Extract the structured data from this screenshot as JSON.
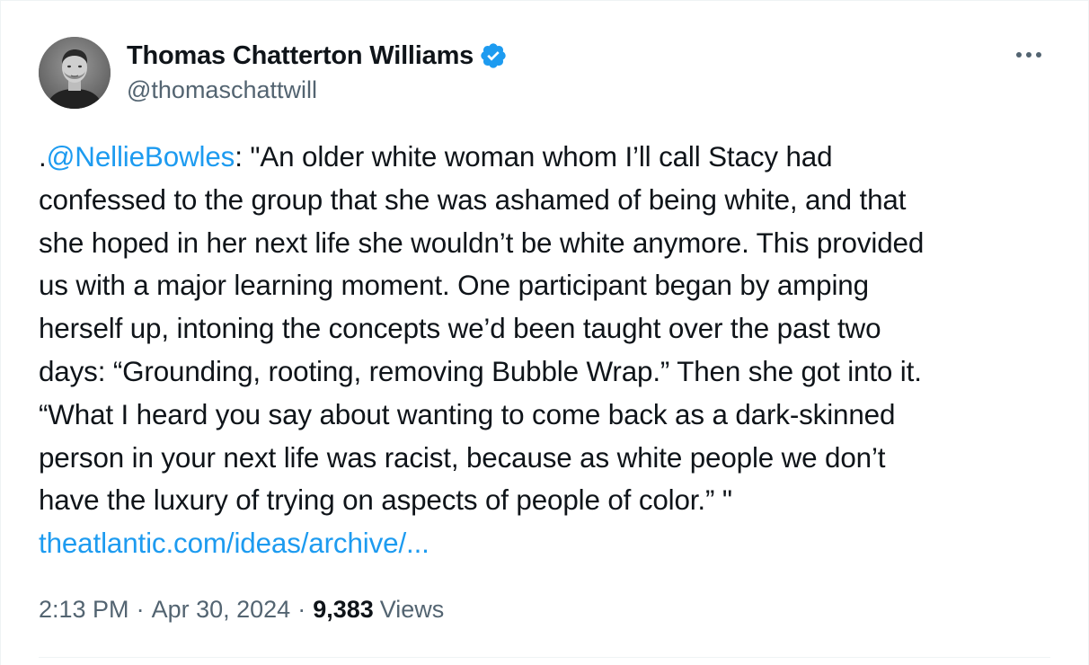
{
  "author": {
    "display_name": "Thomas Chatterton Williams",
    "handle": "@thomaschattwill",
    "verified": true,
    "avatar_icon": "profile-photo"
  },
  "menu_icon": "more-horizontal-icon",
  "tweet": {
    "mention": "@NellieBowles",
    "lines": [
      "\"An older white woman whom I’ll call Stacy had",
      "confessed to the group that she was ashamed of being white, and that",
      "she hoped in her next life she wouldn’t be white anymore. This provided",
      "us with a major learning moment. One participant began by amping",
      "herself up, intoning the concepts we’d been taught over the past two",
      "days: “Grounding, rooting, removing Bubble Wrap.” Then she got into it.",
      "“What I heard you say about wanting to come back as a dark-skinned",
      "person in your next life was racist, because as white people we don’t",
      "have the luxury of trying on aspects of people of color.” \""
    ],
    "link_text": "theatlantic.com/ideas/archive/..."
  },
  "meta": {
    "time": "2:13 PM",
    "date": "Apr 30, 2024",
    "views_count": "9,383",
    "views_label": "Views",
    "separator": "·"
  },
  "colors": {
    "link": "#1d9bf0",
    "verified": "#1d9bf0",
    "secondary_text": "#536471",
    "primary_text": "#0f1419"
  }
}
